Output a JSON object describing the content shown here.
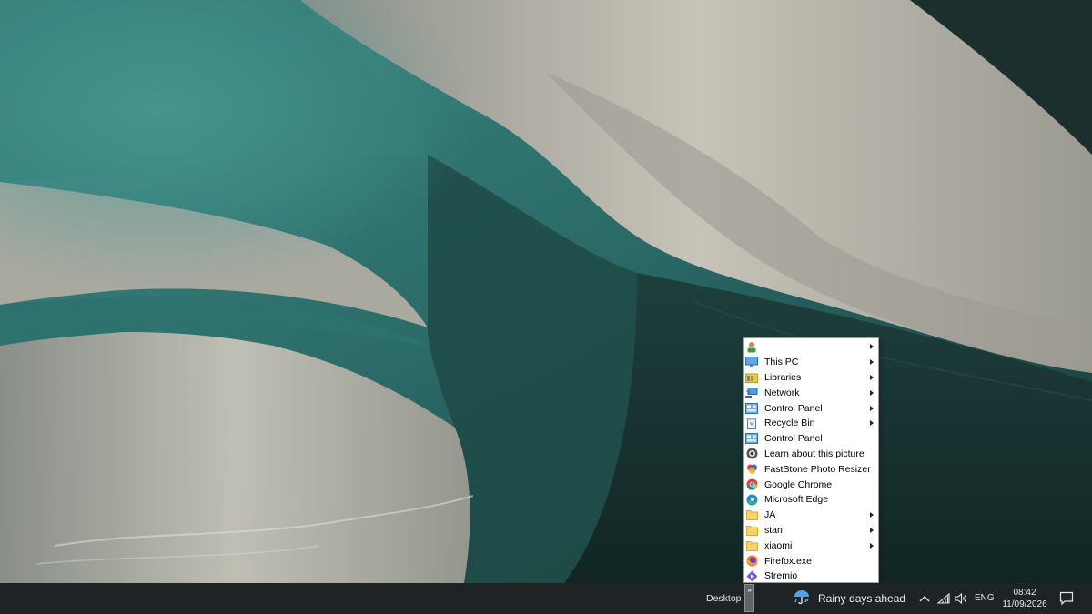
{
  "desktop_menu": {
    "items": [
      {
        "label": "",
        "icon": "user-icon",
        "submenu": true
      },
      {
        "label": "This PC",
        "icon": "monitor-icon",
        "submenu": true
      },
      {
        "label": "Libraries",
        "icon": "libraries-icon",
        "submenu": true
      },
      {
        "label": "Network",
        "icon": "network-icon",
        "submenu": true
      },
      {
        "label": "Control Panel",
        "icon": "control-panel-icon",
        "submenu": true
      },
      {
        "label": "Recycle Bin",
        "icon": "recycle-bin-icon",
        "submenu": true
      },
      {
        "label": "Control Panel",
        "icon": "control-panel-icon",
        "submenu": false
      },
      {
        "label": "Learn about this picture",
        "icon": "camera-icon",
        "submenu": false
      },
      {
        "label": "FastStone Photo Resizer",
        "icon": "faststone-icon",
        "submenu": false
      },
      {
        "label": "Google Chrome",
        "icon": "chrome-icon",
        "submenu": false
      },
      {
        "label": "Microsoft Edge",
        "icon": "edge-icon",
        "submenu": false
      },
      {
        "label": "JA",
        "icon": "folder-icon",
        "submenu": true
      },
      {
        "label": "stan",
        "icon": "folder-icon",
        "submenu": true
      },
      {
        "label": "xiaomi",
        "icon": "folder-icon",
        "submenu": true
      },
      {
        "label": "Firefox.exe",
        "icon": "firefox-icon",
        "submenu": false
      },
      {
        "label": "Stremio",
        "icon": "stremio-icon",
        "submenu": false
      }
    ]
  },
  "taskbar": {
    "toolbar_label": "Desktop",
    "chevron": "»",
    "weather_icon": "umbrella-rain-icon",
    "weather_text": "Rainy days ahead",
    "language": "ENG",
    "time": "08:42",
    "date": "11/09/2026"
  },
  "colors": {
    "taskbar_bg": "#1f2325",
    "menu_bg": "#ffffff",
    "wallpaper_teal": "#2f7370",
    "wallpaper_sand": "#b8b6ab"
  }
}
